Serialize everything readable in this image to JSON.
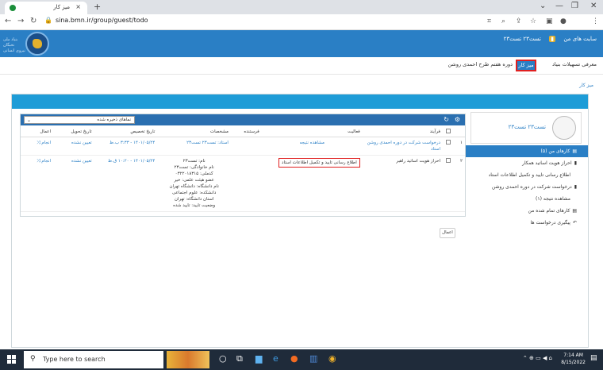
{
  "browser": {
    "tab_title": "میز کار",
    "tab_close": "×",
    "new_tab": "+",
    "win_min": "⌄",
    "win_minimize": "—",
    "win_restore": "❐",
    "win_close": "✕",
    "url": "sina.bmn.ir/group/guest/todo"
  },
  "site": {
    "name_line1": "بنیاد ملی نخبگان",
    "name_line2": "نیروی انسانی",
    "user_links": [
      "سایت های من",
      "تست۲۳ تست۲۳"
    ]
  },
  "menu": {
    "items": [
      "معرفی تسهیلات بنیاد",
      "میز کار",
      "دوره هفتم طرح احمدی روشن"
    ],
    "active": "میز کار"
  },
  "breadcrumb": "میز کار",
  "profile": {
    "name": "تست۲۳ تست۲۳"
  },
  "sidemenu": [
    {
      "label": "کارهای من (۵)",
      "active": true
    },
    {
      "label": "احراز هویت اساتید همکار",
      "active": false
    },
    {
      "label": "اطلاع رسانی تایید و تکمیل اطلاعات استاد",
      "active": false
    },
    {
      "label": "درخواست شرکت در دوره احمدی روشن",
      "active": false
    },
    {
      "label": "مشاهده نتیجه (۱)",
      "active": false
    },
    {
      "label": "کارهای تمام شده من",
      "active": false
    },
    {
      "label": "پیگیری درخواست ها",
      "active": false
    }
  ],
  "tasks": {
    "dropdown": "نماهای ذخیره شده",
    "columns": [
      "",
      "",
      "فرآیند",
      "فعالیت",
      "فرستنده",
      "مشخصات",
      "تاریخ تخصیص",
      "تاریخ تحویل",
      "اعمال"
    ],
    "rows": [
      {
        "num": "۱",
        "process": "درخواست شرکت در دوره احمدی روشن استاد",
        "activity": "مشاهده نتیجه",
        "sender": "",
        "details": "استاد: تست۲۳ تست۲۳",
        "assigned": "۱۴۰۱/۰۵/۲۴ - ۳:۳۳ ب.ظ",
        "due": "تعیین نشده",
        "action": "انجام ⤨"
      },
      {
        "num": "۲",
        "process": "احراز هویت اساتید راهبر",
        "activity": "اطلاع رسانی تایید و تکمیل اطلاعات استاد",
        "sender": "",
        "details": [
          "نام: تست۲۳",
          "نام خانوادگی: تست۲۳",
          "کدملی: ۰۳۲۲۰۱۸۳۱۵",
          "عضو هیئت علمی: خیر",
          "نام دانشگاه: دانشگاه تهران",
          "دانشکده: علوم اجتماعی",
          "استان دانشگاه: تهران",
          "وضعیت تایید: تایید شده"
        ],
        "assigned": "۱۴۰۱/۰۵/۲۴ - ۱۰:۲۰ ق.ظ",
        "due": "تعیین نشده",
        "action": "انجام ⤨"
      }
    ],
    "apply_button": "اعمال"
  },
  "taskbar": {
    "search_placeholder": "Type here to search",
    "time": "7:14 AM",
    "date": "8/15/2022"
  }
}
